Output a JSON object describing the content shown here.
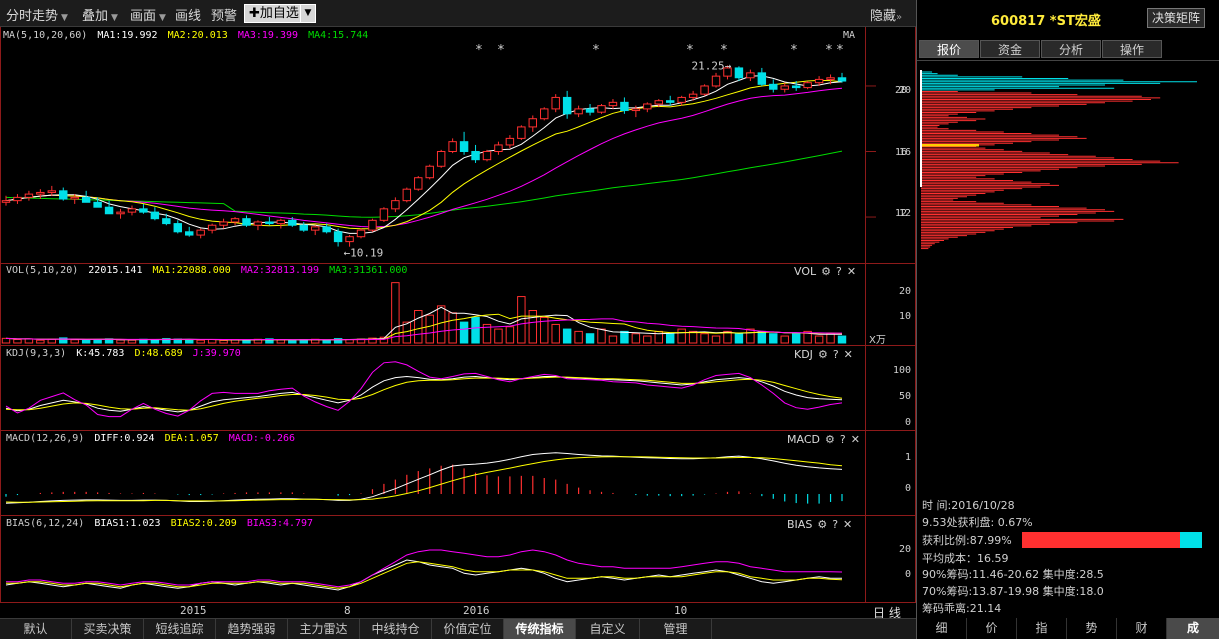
{
  "toolbar": {
    "items": [
      "分时走势",
      "叠加",
      "画面",
      "画线",
      "预警"
    ],
    "add_label": "加自选",
    "hide_label": "隐藏"
  },
  "panels": {
    "ma": {
      "title": "MA(5,10,20,60)",
      "ma1": "MA1:19.992",
      "ma2": "MA2:20.013",
      "ma3": "MA3:19.399",
      "ma4": "MA4:15.744",
      "tag": "MA"
    },
    "vol": {
      "title": "VOL(5,10,20)",
      "value": "22015.141",
      "ma1": "MA1:22088.000",
      "ma2": "MA2:32813.199",
      "ma3": "MA3:31361.000",
      "tag": "VOL",
      "unit": "X万"
    },
    "kdj": {
      "title": "KDJ(9,3,3)",
      "k": "K:45.783",
      "d": "D:48.689",
      "j": "J:39.970",
      "tag": "KDJ"
    },
    "macd": {
      "title": "MACD(12,26,9)",
      "diff": "DIFF:0.924",
      "dea": "DEA:1.057",
      "macd": "MACD:-0.266",
      "tag": "MACD"
    },
    "bias": {
      "title": "BIAS(6,12,24)",
      "b1": "BIAS1:1.023",
      "b2": "BIAS2:0.209",
      "b3": "BIAS3:4.797",
      "tag": "BIAS"
    }
  },
  "glyphs": {
    "gear": "⚙",
    "help": "?",
    "close": "✕"
  },
  "period_label": "日 线",
  "bottom_tabs": [
    "默认",
    "买卖决策",
    "短线追踪",
    "趋势强弱",
    "主力雷达",
    "中线持仓",
    "价值定位",
    "传统指标",
    "自定义",
    "管理"
  ],
  "bottom_active": 7,
  "right_panel": {
    "stock": "600817 *ST宏盛",
    "decision_button": "决策矩阵",
    "tabs": [
      "报价",
      "资金",
      "分析",
      "操作"
    ],
    "active_tab": 0,
    "price_labels": [
      "20",
      "16",
      "12"
    ],
    "info": {
      "time_label": "时        间:",
      "time_value": "2016/10/28",
      "profit_at": "9.53处获利盘: 0.67%",
      "profit_ratio": "获利比例:87.99%",
      "profit_ratio_fraction": 0.8799,
      "avg_cost": "平均成本：16.59",
      "chip90": "90%筹码:11.46-20.62",
      "conc90": "集中度:28.5",
      "chip70": "70%筹码:13.87-19.98",
      "conc70": "集中度:18.0",
      "chip_divergence": "筹码乖离:21.14"
    },
    "bottom_tabs": [
      "细",
      "价",
      "指",
      "势",
      "财",
      "成"
    ],
    "bottom_active": 5
  },
  "colors": {
    "up": "#ff3030",
    "down": "#00e0e8",
    "ma1": "#ffffff",
    "ma2": "#ffff00",
    "ma3": "#ff00ff",
    "ma4": "#00dd00",
    "border": "#8e1a1a"
  },
  "chart_data": {
    "type": "candlestick",
    "x_labels": [
      "2015",
      "8",
      "2016",
      "10"
    ],
    "price_axis": {
      "ticks": [
        20,
        16,
        12
      ],
      "ylim": [
        9.5,
        22.5
      ]
    },
    "annotations": [
      {
        "text": "21.25",
        "kind": "high"
      },
      {
        "text": "10.19",
        "kind": "low"
      }
    ],
    "star_marker": "*",
    "candles": [
      [
        12.9,
        13.3,
        12.7,
        13.0
      ],
      [
        13.0,
        13.4,
        12.8,
        13.2
      ],
      [
        13.2,
        13.6,
        13.0,
        13.4
      ],
      [
        13.4,
        13.7,
        13.1,
        13.5
      ],
      [
        13.5,
        13.9,
        13.3,
        13.6
      ],
      [
        13.6,
        13.8,
        13.0,
        13.1
      ],
      [
        13.1,
        13.4,
        12.8,
        13.2
      ],
      [
        13.2,
        13.6,
        12.9,
        12.9
      ],
      [
        12.9,
        13.2,
        12.6,
        12.6
      ],
      [
        12.6,
        13.0,
        12.2,
        12.2
      ],
      [
        12.2,
        12.5,
        11.9,
        12.3
      ],
      [
        12.3,
        12.7,
        12.1,
        12.5
      ],
      [
        12.5,
        12.8,
        12.2,
        12.3
      ],
      [
        12.3,
        12.6,
        11.8,
        11.9
      ],
      [
        11.9,
        12.2,
        11.5,
        11.6
      ],
      [
        11.6,
        11.8,
        11.0,
        11.1
      ],
      [
        11.1,
        11.4,
        10.8,
        10.9
      ],
      [
        10.9,
        11.3,
        10.7,
        11.2
      ],
      [
        11.2,
        11.6,
        11.0,
        11.5
      ],
      [
        11.5,
        11.9,
        11.3,
        11.7
      ],
      [
        11.7,
        12.0,
        11.5,
        11.9
      ],
      [
        11.9,
        12.1,
        11.4,
        11.5
      ],
      [
        11.5,
        11.8,
        11.2,
        11.7
      ],
      [
        11.7,
        12.0,
        11.5,
        11.6
      ],
      [
        11.6,
        11.9,
        11.3,
        11.8
      ],
      [
        11.8,
        12.0,
        11.4,
        11.5
      ],
      [
        11.5,
        11.7,
        11.1,
        11.2
      ],
      [
        11.2,
        11.5,
        10.9,
        11.4
      ],
      [
        11.4,
        11.6,
        11.0,
        11.1
      ],
      [
        11.1,
        11.3,
        10.2,
        10.5
      ],
      [
        10.5,
        10.9,
        10.19,
        10.8
      ],
      [
        10.8,
        11.3,
        10.7,
        11.2
      ],
      [
        11.2,
        11.9,
        11.1,
        11.8
      ],
      [
        11.8,
        12.6,
        11.7,
        12.5
      ],
      [
        12.5,
        13.2,
        12.3,
        13.0
      ],
      [
        13.0,
        13.8,
        12.9,
        13.7
      ],
      [
        13.7,
        14.5,
        13.6,
        14.4
      ],
      [
        14.4,
        15.2,
        14.3,
        15.1
      ],
      [
        15.1,
        16.1,
        15.0,
        16.0
      ],
      [
        16.0,
        16.8,
        15.9,
        16.6
      ],
      [
        16.6,
        17.2,
        15.8,
        16.0
      ],
      [
        16.0,
        16.4,
        15.3,
        15.5
      ],
      [
        15.5,
        16.1,
        15.4,
        16.0
      ],
      [
        16.0,
        16.6,
        15.8,
        16.4
      ],
      [
        16.4,
        17.0,
        16.2,
        16.8
      ],
      [
        16.8,
        17.6,
        16.7,
        17.5
      ],
      [
        17.5,
        18.2,
        17.2,
        18.0
      ],
      [
        18.0,
        18.7,
        17.9,
        18.6
      ],
      [
        18.6,
        19.5,
        18.4,
        19.3
      ],
      [
        19.3,
        19.7,
        18.0,
        18.3
      ],
      [
        18.3,
        18.8,
        18.1,
        18.6
      ],
      [
        18.6,
        18.9,
        18.2,
        18.4
      ],
      [
        18.4,
        18.9,
        18.3,
        18.8
      ],
      [
        18.8,
        19.2,
        18.6,
        19.0
      ],
      [
        19.0,
        19.3,
        18.3,
        18.5
      ],
      [
        18.5,
        18.8,
        18.1,
        18.6
      ],
      [
        18.6,
        19.0,
        18.4,
        18.9
      ],
      [
        18.9,
        19.2,
        18.7,
        19.1
      ],
      [
        19.1,
        19.4,
        18.8,
        19.0
      ],
      [
        19.0,
        19.4,
        18.8,
        19.3
      ],
      [
        19.3,
        19.7,
        19.1,
        19.5
      ],
      [
        19.5,
        20.1,
        19.4,
        20.0
      ],
      [
        20.0,
        20.8,
        19.9,
        20.6
      ],
      [
        20.6,
        21.25,
        20.4,
        21.1
      ],
      [
        21.1,
        21.2,
        20.3,
        20.5
      ],
      [
        20.5,
        21.0,
        20.3,
        20.8
      ],
      [
        20.8,
        21.1,
        20.0,
        20.1
      ],
      [
        20.1,
        20.4,
        19.6,
        19.8
      ],
      [
        19.8,
        20.2,
        19.6,
        20.0
      ],
      [
        20.0,
        20.3,
        19.7,
        19.9
      ],
      [
        19.9,
        20.3,
        19.8,
        20.2
      ],
      [
        20.2,
        20.6,
        20.0,
        20.4
      ],
      [
        20.4,
        20.7,
        20.1,
        20.5
      ],
      [
        20.5,
        20.8,
        20.2,
        20.3
      ]
    ],
    "volume": {
      "ticks": [
        20,
        10
      ],
      "ylim": [
        0,
        28
      ],
      "values": [
        2,
        1.5,
        1.8,
        1.2,
        1.6,
        2.2,
        1.4,
        1.1,
        1.5,
        1.8,
        1.3,
        1.2,
        1.6,
        1.4,
        1.9,
        1.7,
        1.3,
        1.2,
        1.5,
        1.1,
        1.4,
        1.2,
        1.6,
        1.8,
        1.3,
        1.1,
        1.4,
        1.6,
        1.2,
        1.9,
        1.5,
        1.7,
        2.1,
        2.5,
        26,
        9,
        14,
        12,
        16,
        13,
        9,
        11,
        8,
        6,
        7,
        20,
        14,
        11,
        8,
        6,
        5,
        4,
        6,
        3,
        5,
        4,
        3,
        5,
        4,
        6,
        5,
        4,
        3,
        5,
        4,
        6,
        5,
        4,
        3,
        4,
        5,
        3,
        4,
        3
      ]
    },
    "kdj": {
      "ticks": [
        100,
        50,
        0
      ],
      "ylim": [
        0,
        110
      ],
      "k": [
        30,
        25,
        28,
        35,
        40,
        45,
        42,
        38,
        30,
        26,
        24,
        28,
        33,
        30,
        26,
        23,
        26,
        34,
        42,
        46,
        48,
        50,
        52,
        55,
        58,
        60,
        55,
        50,
        45,
        40,
        45,
        55,
        70,
        82,
        88,
        90,
        88,
        85,
        84,
        86,
        89,
        90,
        88,
        86,
        84,
        86,
        88,
        90,
        90,
        88,
        87,
        86,
        85,
        84,
        83,
        82,
        80,
        78,
        76,
        74,
        76,
        80,
        84,
        86,
        88,
        86,
        80,
        72,
        62,
        55,
        50,
        48,
        47,
        46
      ],
      "d": [
        28,
        27,
        27,
        30,
        34,
        38,
        40,
        39,
        36,
        32,
        29,
        28,
        30,
        31,
        29,
        27,
        26,
        29,
        34,
        39,
        43,
        46,
        49,
        51,
        54,
        56,
        56,
        54,
        51,
        47,
        46,
        49,
        56,
        65,
        73,
        79,
        82,
        83,
        83,
        84,
        86,
        87,
        87,
        87,
        86,
        86,
        87,
        88,
        89,
        89,
        88,
        87,
        86,
        86,
        85,
        84,
        83,
        81,
        79,
        77,
        77,
        78,
        80,
        82,
        84,
        85,
        83,
        79,
        73,
        67,
        61,
        56,
        52,
        49
      ],
      "j": [
        34,
        21,
        30,
        45,
        52,
        59,
        46,
        36,
        18,
        14,
        14,
        28,
        39,
        28,
        20,
        15,
        26,
        44,
        58,
        60,
        58,
        58,
        58,
        63,
        66,
        68,
        53,
        42,
        33,
        26,
        43,
        67,
        98,
        116,
        118,
        112,
        100,
        89,
        86,
        90,
        95,
        96,
        90,
        84,
        80,
        86,
        90,
        94,
        92,
        86,
        85,
        84,
        83,
        80,
        79,
        78,
        74,
        72,
        70,
        68,
        74,
        84,
        92,
        94,
        96,
        88,
        74,
        58,
        40,
        31,
        28,
        32,
        37,
        40
      ]
    },
    "macd": {
      "ticks": [
        1,
        0
      ],
      "ylim": [
        -0.6,
        1.8
      ],
      "diff": [
        -0.35,
        -0.33,
        -0.31,
        -0.28,
        -0.26,
        -0.24,
        -0.23,
        -0.22,
        -0.22,
        -0.23,
        -0.24,
        -0.24,
        -0.23,
        -0.23,
        -0.24,
        -0.26,
        -0.28,
        -0.28,
        -0.27,
        -0.25,
        -0.23,
        -0.21,
        -0.2,
        -0.19,
        -0.18,
        -0.18,
        -0.19,
        -0.2,
        -0.21,
        -0.24,
        -0.24,
        -0.2,
        -0.1,
        0.05,
        0.2,
        0.38,
        0.55,
        0.72,
        0.9,
        1.05,
        1.1,
        1.12,
        1.16,
        1.22,
        1.3,
        1.4,
        1.48,
        1.52,
        1.55,
        1.52,
        1.48,
        1.45,
        1.43,
        1.42,
        1.4,
        1.38,
        1.36,
        1.35,
        1.33,
        1.32,
        1.32,
        1.34,
        1.36,
        1.4,
        1.42,
        1.38,
        1.32,
        1.24,
        1.15,
        1.08,
        1.02,
        0.98,
        0.95,
        0.924
      ],
      "dea": [
        -0.3,
        -0.31,
        -0.31,
        -0.3,
        -0.29,
        -0.28,
        -0.27,
        -0.26,
        -0.25,
        -0.25,
        -0.25,
        -0.25,
        -0.25,
        -0.24,
        -0.24,
        -0.25,
        -0.26,
        -0.26,
        -0.26,
        -0.26,
        -0.25,
        -0.24,
        -0.23,
        -0.22,
        -0.21,
        -0.21,
        -0.2,
        -0.2,
        -0.21,
        -0.21,
        -0.22,
        -0.21,
        -0.19,
        -0.14,
        -0.07,
        0.02,
        0.12,
        0.24,
        0.37,
        0.5,
        0.62,
        0.72,
        0.81,
        0.89,
        0.97,
        1.06,
        1.14,
        1.22,
        1.28,
        1.33,
        1.36,
        1.38,
        1.39,
        1.4,
        1.4,
        1.4,
        1.39,
        1.38,
        1.37,
        1.36,
        1.35,
        1.35,
        1.35,
        1.36,
        1.37,
        1.37,
        1.36,
        1.33,
        1.29,
        1.25,
        1.2,
        1.16,
        1.1,
        1.057
      ]
    },
    "bias": {
      "ticks": [
        20,
        0
      ],
      "ylim": [
        -12,
        30
      ],
      "b1": [
        -3,
        -2,
        -1,
        -2,
        -3,
        -4,
        -3,
        -2,
        -3,
        -4,
        -5,
        -3,
        -2,
        -3,
        -4,
        -5,
        -4,
        -2,
        -1,
        -2,
        -3,
        -2,
        -1,
        -2,
        -3,
        -2,
        -3,
        -4,
        -5,
        -6,
        -4,
        -1,
        3,
        6,
        9,
        12,
        11,
        9,
        8,
        7,
        4,
        3,
        4,
        5,
        6,
        7,
        6,
        4,
        1,
        -1,
        0,
        1,
        2,
        1,
        0,
        1,
        2,
        3,
        2,
        3,
        4,
        5,
        6,
        5,
        3,
        1,
        -1,
        -2,
        -1,
        0,
        1,
        2,
        1,
        1.023
      ],
      "b2": [
        -2,
        -2,
        -1,
        -1,
        -2,
        -3,
        -3,
        -2,
        -2,
        -3,
        -4,
        -3,
        -2,
        -2,
        -3,
        -4,
        -4,
        -3,
        -2,
        -2,
        -2,
        -2,
        -1,
        -1,
        -2,
        -2,
        -2,
        -3,
        -4,
        -5,
        -4,
        -2,
        1,
        4,
        7,
        10,
        11,
        10,
        9,
        8,
        6,
        5,
        5,
        5,
        6,
        6,
        6,
        5,
        3,
        1,
        1,
        1,
        2,
        2,
        1,
        1,
        2,
        2,
        2,
        2,
        3,
        4,
        5,
        5,
        4,
        2,
        1,
        0,
        0,
        0,
        1,
        1,
        0.5,
        0.209
      ],
      "b3": [
        -1,
        -1,
        0,
        0,
        -1,
        -2,
        -2,
        -1,
        -1,
        -2,
        -3,
        -2,
        -1,
        -1,
        -2,
        -3,
        -3,
        -2,
        -1,
        -1,
        -1,
        -1,
        0,
        0,
        -1,
        -1,
        -1,
        -2,
        -3,
        -4,
        -3,
        -1,
        3,
        7,
        11,
        15,
        17,
        18,
        18,
        17,
        16,
        15,
        14,
        14,
        15,
        17,
        18,
        17,
        15,
        12,
        10,
        9,
        8,
        8,
        7,
        7,
        7,
        7,
        7,
        8,
        9,
        10,
        11,
        11,
        10,
        8,
        7,
        6,
        5,
        5,
        5,
        5,
        5,
        4.797
      ]
    }
  }
}
